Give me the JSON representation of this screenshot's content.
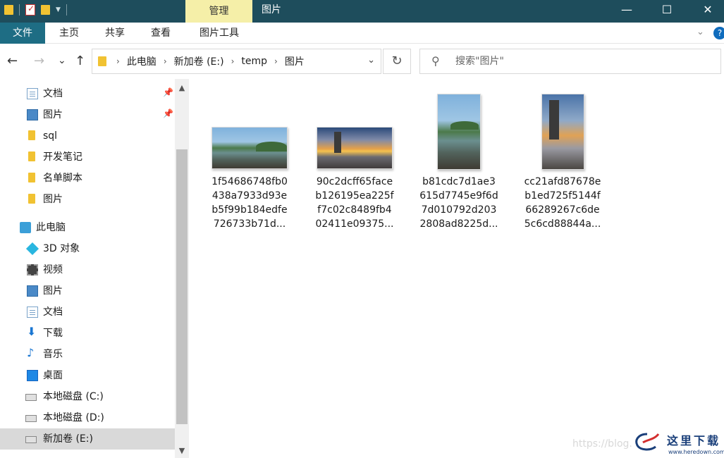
{
  "titlebar": {
    "manage_tab": "管理",
    "window_title": "图片",
    "minimize": "—",
    "maximize": "☐",
    "close": "✕"
  },
  "ribbon": {
    "tabs": [
      "文件",
      "主页",
      "共享",
      "查看",
      "图片工具"
    ],
    "help": "?"
  },
  "nav": {
    "back": "←",
    "forward": "→",
    "recent": "⌄",
    "up": "↑",
    "breadcrumb": [
      "此电脑",
      "新加卷 (E:)",
      "temp",
      "图片"
    ],
    "refresh": "↻",
    "search_placeholder": "搜索\"图片\""
  },
  "sidebar": {
    "quick_access": [
      {
        "label": "文档",
        "icon": "document-icon",
        "pinned": true
      },
      {
        "label": "图片",
        "icon": "pictures-icon",
        "pinned": true
      },
      {
        "label": "sql",
        "icon": "folder-icon",
        "pinned": false
      },
      {
        "label": "开发笔记",
        "icon": "folder-icon",
        "pinned": false
      },
      {
        "label": "名单脚本",
        "icon": "folder-icon",
        "pinned": false
      },
      {
        "label": "图片",
        "icon": "folder-icon",
        "pinned": false
      }
    ],
    "this_pc": "此电脑",
    "pc_items": [
      {
        "label": "3D 对象",
        "icon": "3d-objects-icon"
      },
      {
        "label": "视频",
        "icon": "videos-icon"
      },
      {
        "label": "图片",
        "icon": "pictures-icon"
      },
      {
        "label": "文档",
        "icon": "document-icon"
      },
      {
        "label": "下载",
        "icon": "download-icon"
      },
      {
        "label": "音乐",
        "icon": "music-icon"
      },
      {
        "label": "桌面",
        "icon": "desktop-icon"
      },
      {
        "label": "本地磁盘 (C:)",
        "icon": "drive-icon"
      },
      {
        "label": "本地磁盘 (D:)",
        "icon": "drive-icon"
      },
      {
        "label": "新加卷 (E:)",
        "icon": "drive-icon",
        "selected": true
      }
    ]
  },
  "files": [
    {
      "name_lines": [
        "1f54686748fb0",
        "438a7933d93e",
        "b5f99b184edfe",
        "726733b71d..."
      ],
      "thumb": "lake-landscape"
    },
    {
      "name_lines": [
        "90c2dcff65face",
        "b126195ea225f",
        "f7c02c8489fb4",
        "02411e09375..."
      ],
      "thumb": "lighthouse-sunset"
    },
    {
      "name_lines": [
        "b81cdc7d1ae3",
        "615d7745e9f6d",
        "7d010792d203",
        "2808ad8225d..."
      ],
      "thumb": "lake-portrait"
    },
    {
      "name_lines": [
        "cc21afd87678e",
        "b1ed725f5144f",
        "66289267c6de",
        "5c6cd88844a..."
      ],
      "thumb": "lighthouse-portrait"
    }
  ],
  "watermark": {
    "url": "https://blog.",
    "logo_text": "这里下载",
    "site": "www.heredown.com"
  }
}
